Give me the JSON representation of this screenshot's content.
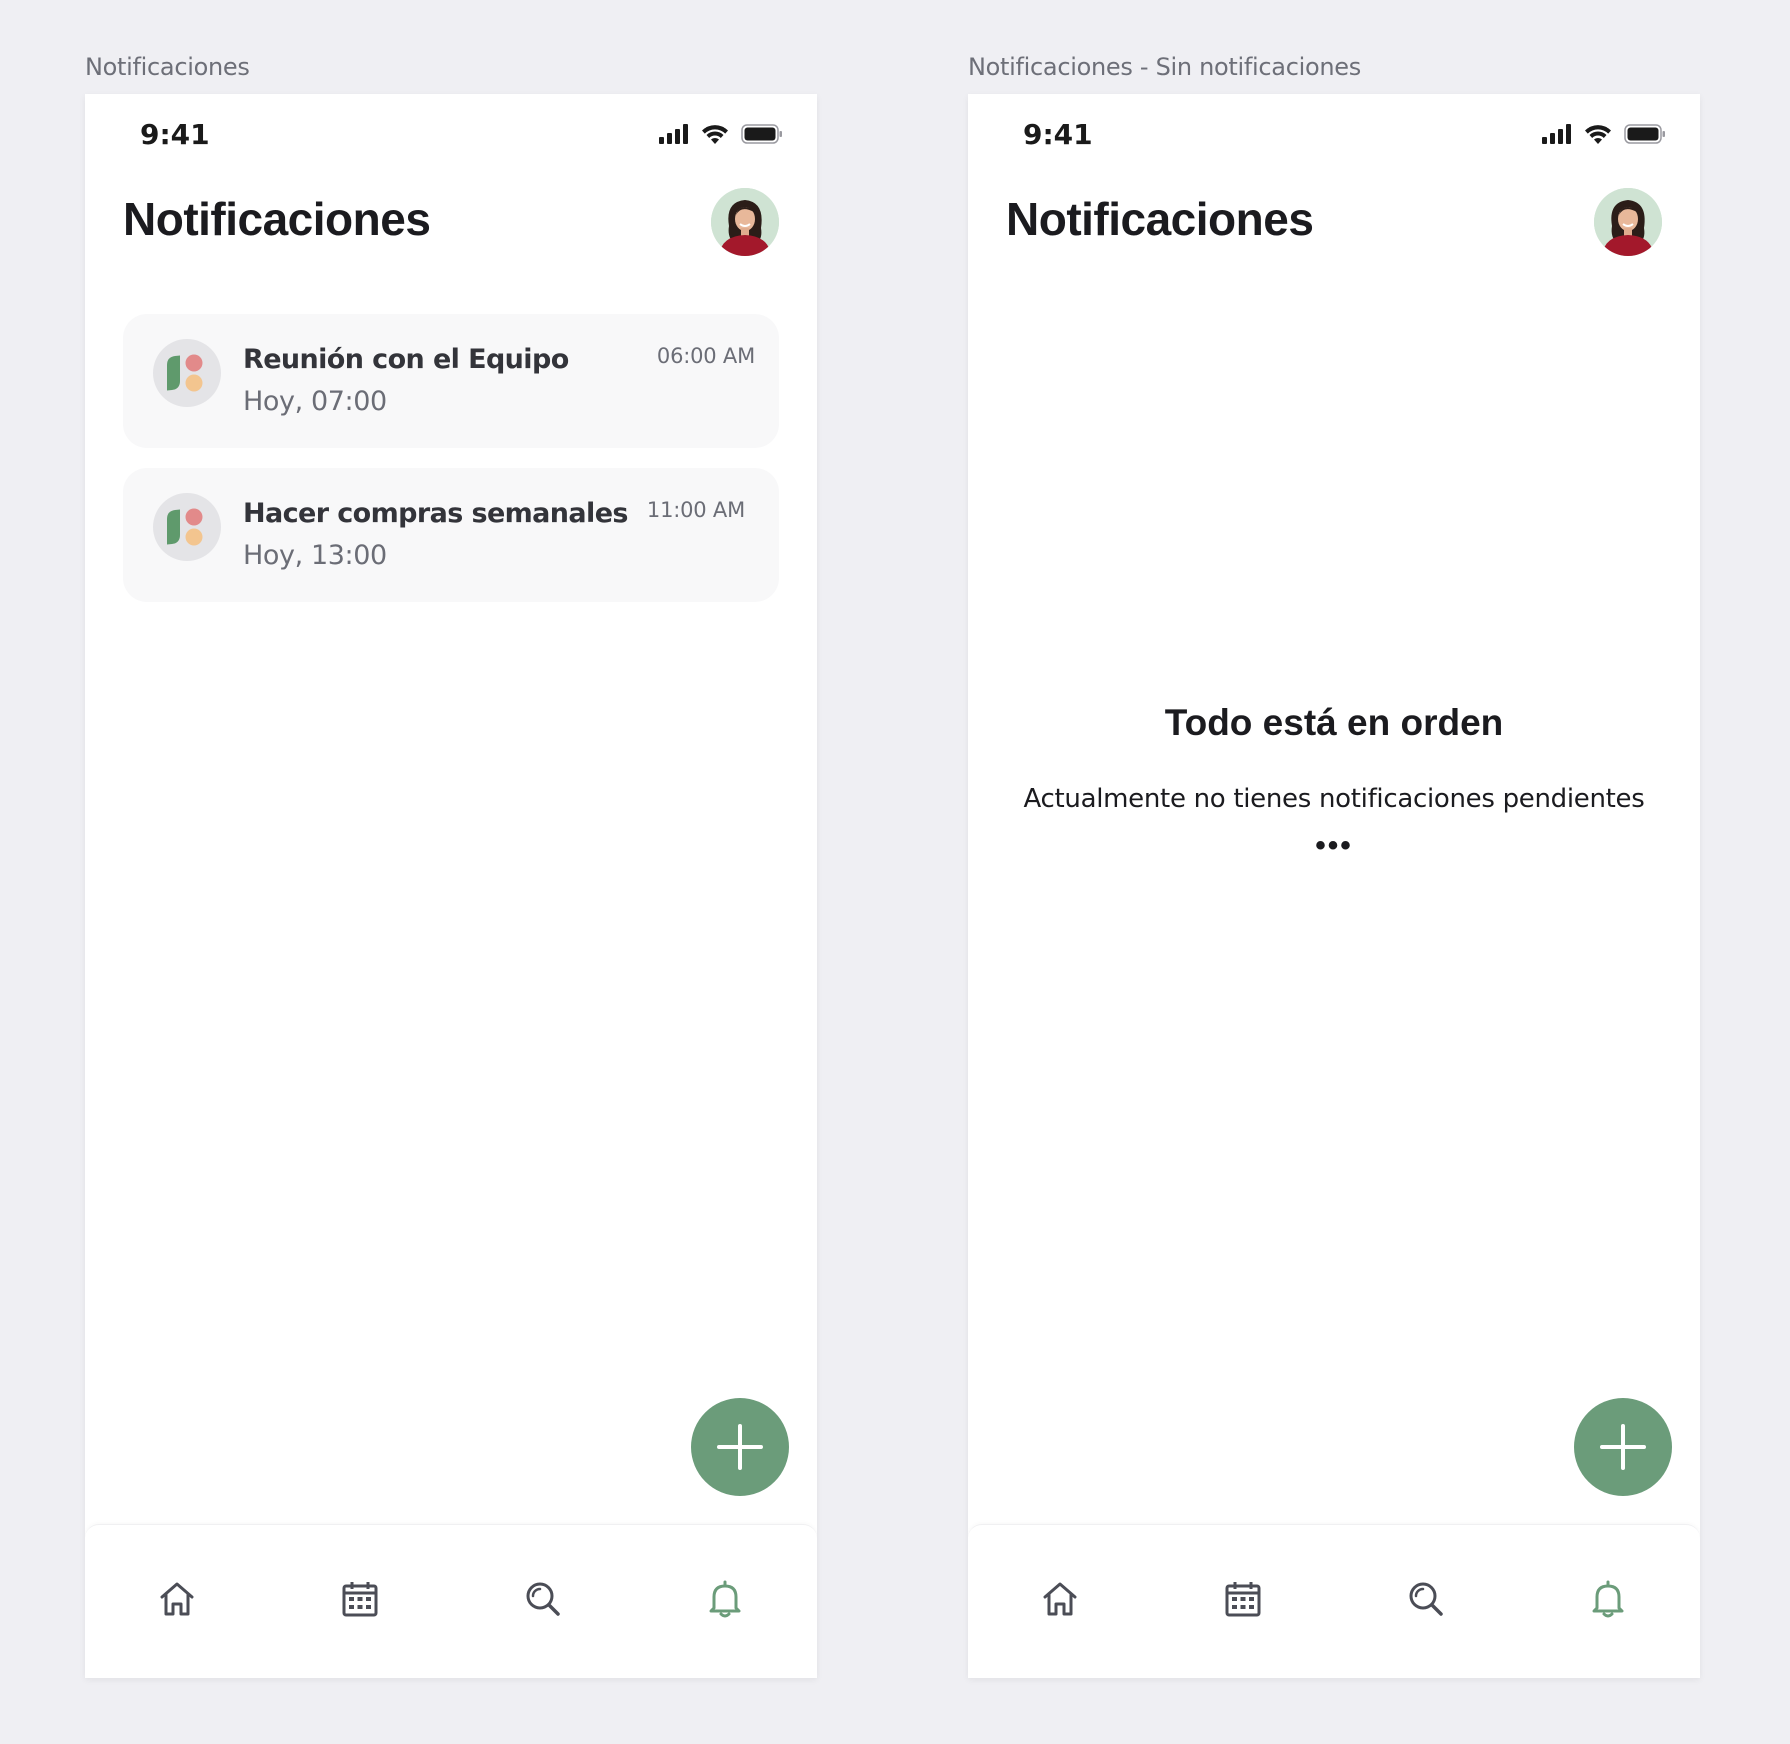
{
  "colors": {
    "background": "#efeff3",
    "accent": "#6b9c7a",
    "title": "#1b1b1f",
    "muted": "#6b6d76",
    "card": "#f8f8f9",
    "icon_gray": "#4b4d56"
  },
  "frames": [
    {
      "label": "Notificaciones",
      "status_time": "9:41",
      "title": "Notificaciones",
      "notifications": [
        {
          "title": "Reunión con el Equipo",
          "subtitle": "Hoy, 07:00",
          "time": "06:00 AM"
        },
        {
          "title": "Hacer compras semanales",
          "subtitle": "Hoy, 13:00",
          "time": "11:00 AM"
        }
      ],
      "tabs": [
        "home-icon",
        "calendar-icon",
        "search-icon",
        "bell-icon"
      ],
      "active_tab": "bell-icon"
    },
    {
      "label": "Notificaciones - Sin notificaciones",
      "status_time": "9:41",
      "title": "Notificaciones",
      "empty_title": "Todo está en orden",
      "empty_subtitle": "Actualmente no tienes notificaciones pendientes",
      "empty_dots": "•••",
      "tabs": [
        "home-icon",
        "calendar-icon",
        "search-icon",
        "bell-icon"
      ],
      "active_tab": "bell-icon"
    }
  ]
}
